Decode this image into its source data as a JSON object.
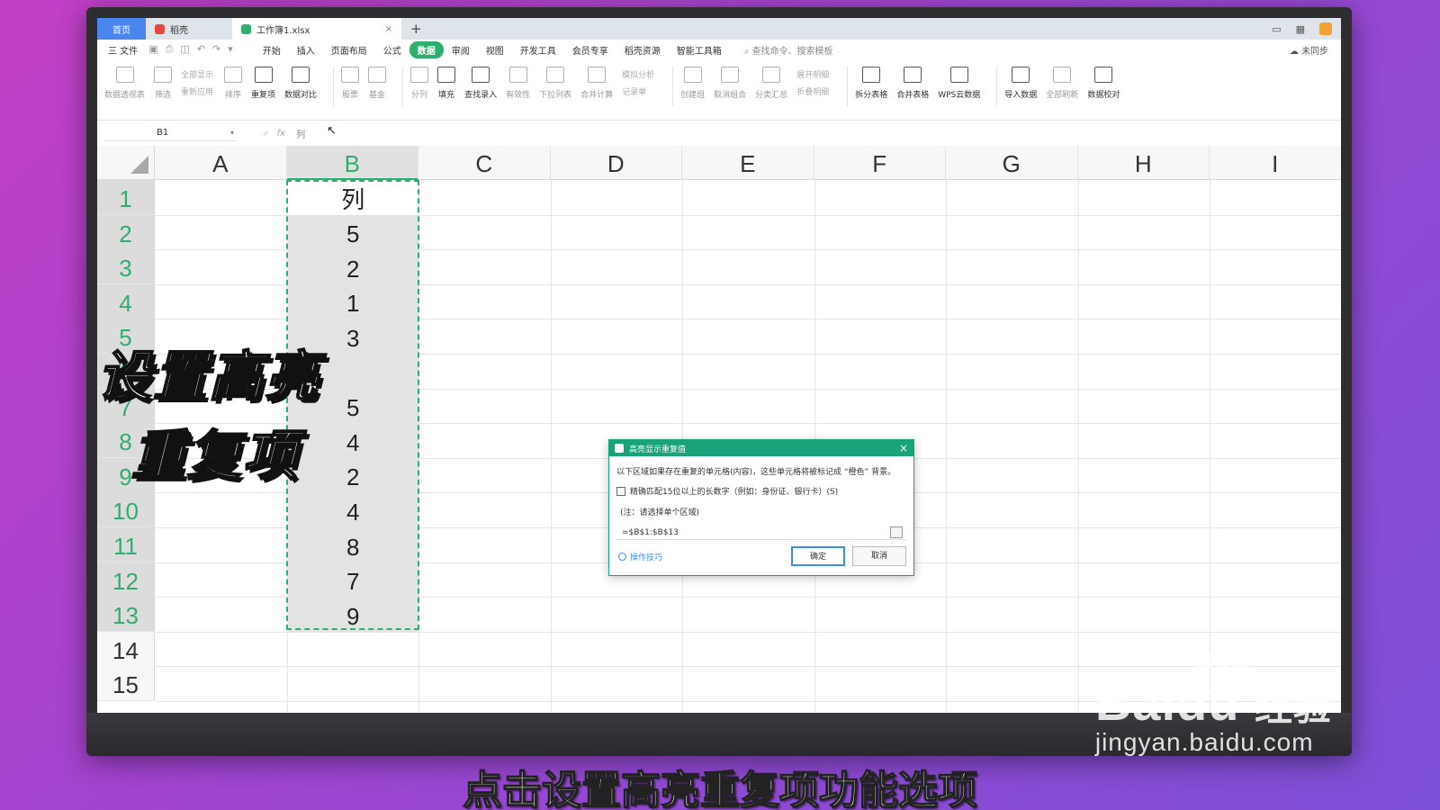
{
  "tabs": {
    "home": "首页",
    "doc": "稻壳",
    "active": "工作簿1.xlsx",
    "plus": "+"
  },
  "window": {
    "sync": "未同步"
  },
  "menu": {
    "file": "三 文件",
    "items": [
      "开始",
      "插入",
      "页面布局",
      "公式",
      "数据",
      "审阅",
      "视图",
      "开发工具",
      "会员专享",
      "稻壳资源",
      "智能工具箱"
    ],
    "active_index": 4,
    "search": "查找命令、搜索模板"
  },
  "ribbon": {
    "pivot": "数据透视表",
    "filter": "筛选",
    "show_all": "全部显示",
    "reapply": "重新应用",
    "sort": "排序",
    "duplicates": "重复项",
    "compare": "数据对比",
    "stock": "股票",
    "fund": "基金",
    "split": "分列",
    "fill": "填充",
    "lookup": "查找录入",
    "validity": "有效性",
    "dropdown": "下拉列表",
    "consolidate": "合并计算",
    "simulate": "模拟分析",
    "record": "记录单",
    "group": "创建组",
    "ungroup": "取消组合",
    "subtotal": "分类汇总",
    "expand": "展开明细",
    "collapse": "折叠明细",
    "split_table": "拆分表格",
    "merge_table": "合并表格",
    "wps_cloud": "WPS云数据",
    "import": "导入数据",
    "refresh_all": "全部刷新",
    "verify": "数据校对"
  },
  "formula_bar": {
    "cell_ref": "B1",
    "fx": "fx",
    "value": "列"
  },
  "grid": {
    "columns": [
      "A",
      "B",
      "C",
      "D",
      "E",
      "F",
      "G",
      "H",
      "I"
    ],
    "selected_column": "B",
    "rows": [
      "1",
      "2",
      "3",
      "4",
      "5",
      "6",
      "7",
      "8",
      "9",
      "10",
      "11",
      "12",
      "13",
      "14",
      "15"
    ],
    "column_b": [
      "列",
      "5",
      "2",
      "1",
      "3",
      "",
      "5",
      "4",
      "2",
      "4",
      "8",
      "7",
      "9"
    ]
  },
  "dialog": {
    "title": "高亮显示重复值",
    "description": "以下区域如果存在重复的单元格(内容)，这些单元格将被标记成 “橙色” 背景。",
    "checkbox": "精确匹配15位以上的长数字（例如：身份证、银行卡）(S)",
    "note": "(注：请选择单个区域)",
    "range": "=$B$1:$B$13",
    "tips": "操作技巧",
    "ok": "确定",
    "cancel": "取消"
  },
  "overlay": {
    "line1": "设置高亮",
    "line2": "重复项",
    "subtitle": "点击设置高亮重复项功能选项"
  },
  "watermark": {
    "brand": "Baidu",
    "brand_suffix": "经验",
    "url": "jingyan.baidu.com"
  },
  "colors": {
    "accent_green": "#2fae6d",
    "dialog_header": "#1aa27a",
    "home_tab": "#4b86f0"
  }
}
